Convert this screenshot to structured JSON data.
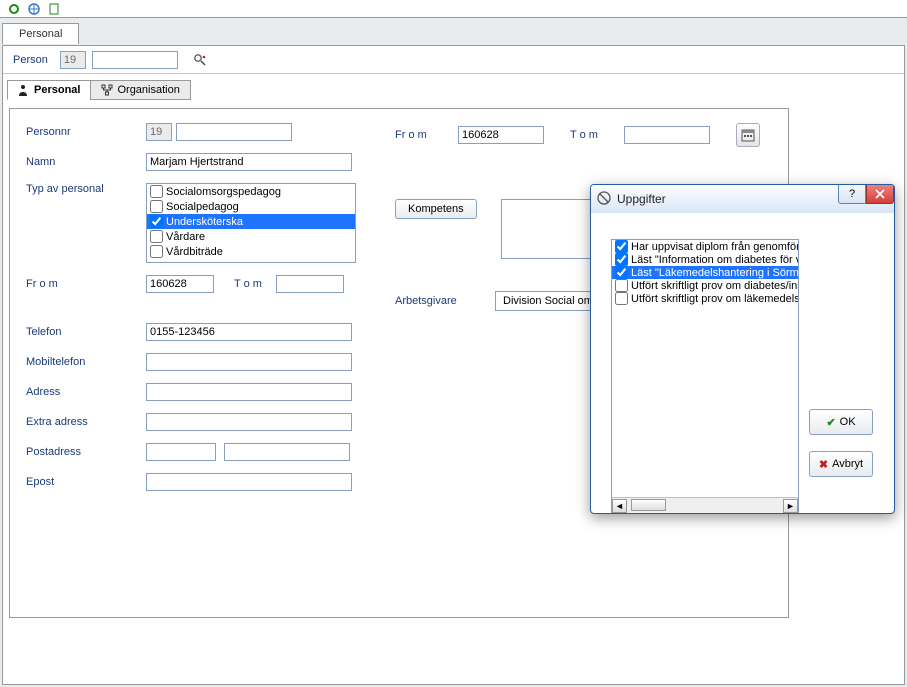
{
  "toolbar": {},
  "main_tab": "Personal",
  "person_bar": {
    "label": "Person",
    "prefix": "19",
    "value": ""
  },
  "form_tabs": {
    "personal": "Personal",
    "organisation": "Organisation"
  },
  "left": {
    "personnr_label": "Personnr",
    "personnr_prefix": "19",
    "personnr_value": "",
    "namn_label": "Namn",
    "namn_value": "Marjam Hjertstrand",
    "typ_label": "Typ av personal",
    "typ_options": [
      {
        "label": "Socialomsorgspedagog",
        "checked": false,
        "selected": false
      },
      {
        "label": "Socialpedagog",
        "checked": false,
        "selected": false
      },
      {
        "label": "Undersköterska",
        "checked": true,
        "selected": true
      },
      {
        "label": "Vårdare",
        "checked": false,
        "selected": false
      },
      {
        "label": "Vårdbiträde",
        "checked": false,
        "selected": false
      }
    ],
    "from_label": "Fr o m",
    "from_value": "160628",
    "tom_label": "T o m",
    "tom_value": "",
    "telefon_label": "Telefon",
    "telefon_value": "0155-123456",
    "mobil_label": "Mobiltelefon",
    "mobil_value": "",
    "adress_label": "Adress",
    "adress_value": "",
    "extra_label": "Extra adress",
    "extra_value": "",
    "post_label": "Postadress",
    "post_zip": "",
    "post_city": "",
    "epost_label": "Epost",
    "epost_value": ""
  },
  "right": {
    "from_label": "Fr o m",
    "from_value": "160628",
    "tom_label": "T o m",
    "tom_value": "",
    "kompetens_btn": "Kompetens",
    "arbetsgivare_label": "Arbetsgivare",
    "arbetsgivare_value": "Division Social oms"
  },
  "modal": {
    "title": "Uppgifter",
    "items": [
      {
        "label": "Har uppvisat diplom från genomförd",
        "checked": true,
        "selected": false
      },
      {
        "label": "Läst \"Information om diabetes för vå",
        "checked": true,
        "selected": false
      },
      {
        "label": "Läst \"Läkemedelshantering i Sörmla",
        "checked": true,
        "selected": true
      },
      {
        "label": "Utfört skriftligt prov om diabetes/insu",
        "checked": false,
        "selected": false
      },
      {
        "label": "Utfört skriftligt prov om läkemedelsha",
        "checked": false,
        "selected": false
      }
    ],
    "ok": "OK",
    "cancel": "Avbryt"
  }
}
